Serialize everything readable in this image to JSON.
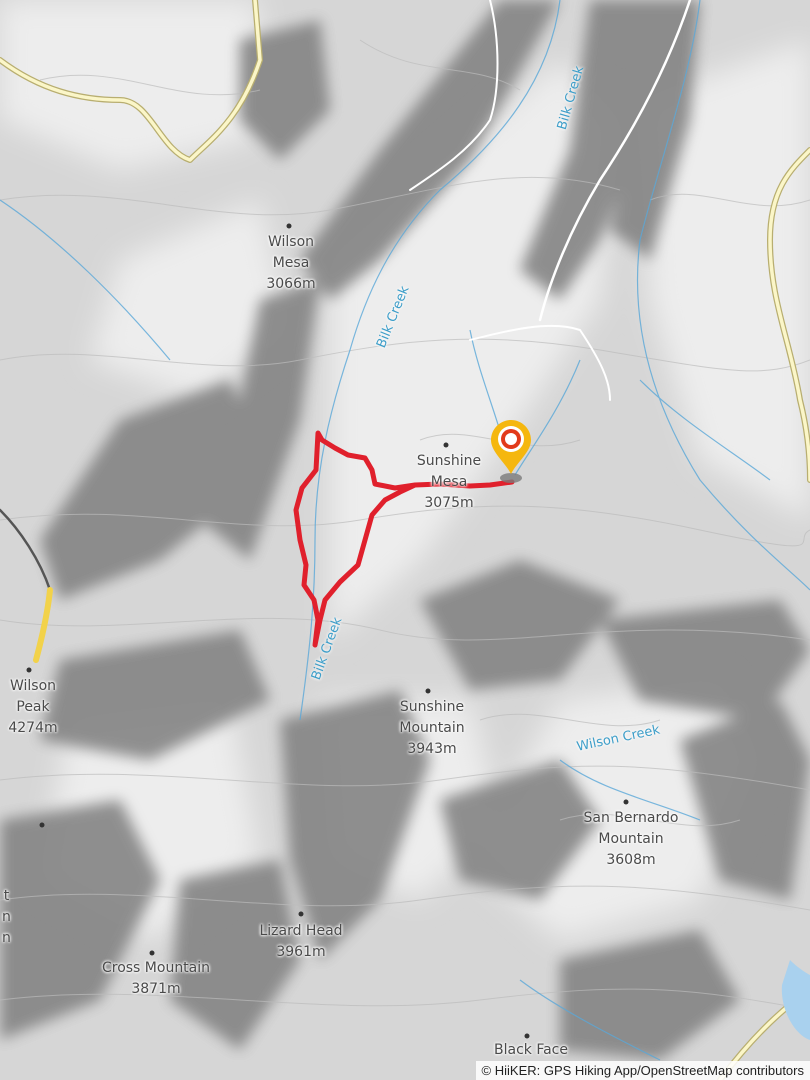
{
  "map": {
    "colors": {
      "terrain_base": "#d9d9d9",
      "terrain_light": "#ececec",
      "hillshade_dark": "#7a7a7a",
      "contour": "#bdbdbd",
      "stream": "#5aa8d8",
      "road_fill": "#fbf6c8",
      "road_casing": "#b8ae70",
      "trail_route": "#e0202c",
      "highlight_route": "#f2d24a",
      "marker_outer": "#f5b70f",
      "marker_inner": "#e23a1a"
    },
    "peaks": [
      {
        "id": "wilson-mesa",
        "name": "Wilson",
        "name2": "Mesa",
        "elevation": "3066m"
      },
      {
        "id": "sunshine-mesa",
        "name": "Sunshine",
        "name2": "Mesa",
        "elevation": "3075m"
      },
      {
        "id": "wilson-peak",
        "name": "Wilson",
        "name2": "Peak",
        "elevation": "4274m"
      },
      {
        "id": "sunshine-mountain",
        "name": "Sunshine",
        "name2": "Mountain",
        "elevation": "3943m"
      },
      {
        "id": "san-bernardo-mountain",
        "name": "San Bernardo",
        "name2": "Mountain",
        "elevation": "3608m"
      },
      {
        "id": "lizard-head",
        "name": "Lizard Head",
        "name2": "",
        "elevation": "3961m"
      },
      {
        "id": "cross-mountain",
        "name": "Cross Mountain",
        "name2": "",
        "elevation": "3871m"
      },
      {
        "id": "black-face",
        "name": "Black Face",
        "name2": "",
        "elevation": ""
      }
    ],
    "waterways": [
      {
        "id": "bilk-creek-north",
        "name": "Bilk Creek"
      },
      {
        "id": "bilk-creek-middle",
        "name": "Bilk Creek"
      },
      {
        "id": "bilk-creek-south",
        "name": "Bilk Creek"
      },
      {
        "id": "wilson-creek",
        "name": "Wilson Creek"
      }
    ],
    "edge_fragments": [
      "t",
      "n",
      "n"
    ],
    "attribution": "© HiiKER: GPS Hiking App/OpenStreetMap contributors"
  }
}
